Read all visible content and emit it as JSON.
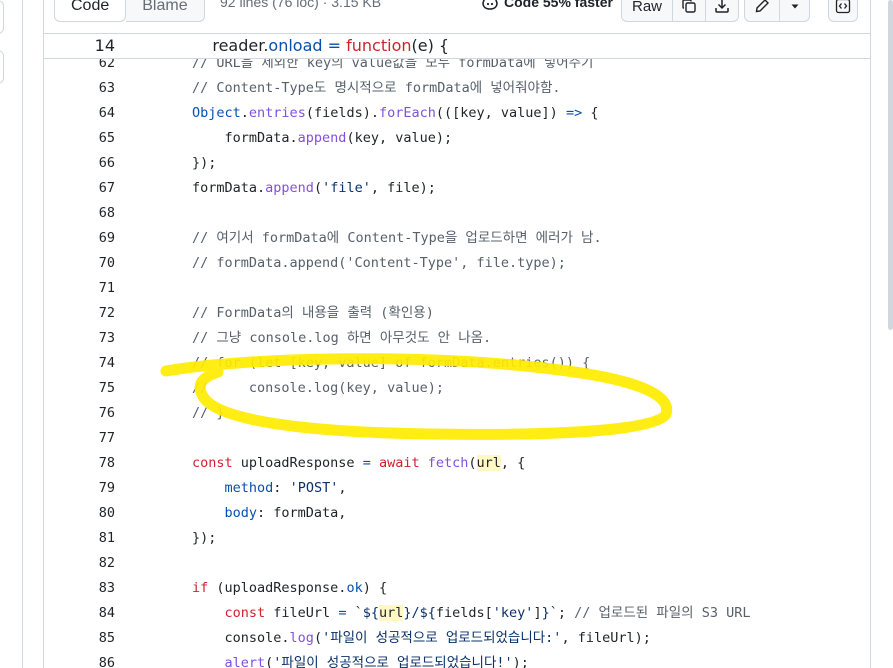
{
  "toolbar": {
    "code_label": "Code",
    "blame_label": "Blame",
    "file_meta": "92 lines (76 loc) · 3.15 KB",
    "copilot_label": "Code 55% faster",
    "raw_label": "Raw"
  },
  "sticky_line": {
    "num": "14",
    "html": "    reader.<span class=\"pr\">onload</span> <span class=\"op\">=</span> <span class=\"kw\">function</span>(e) {"
  },
  "code_lines": [
    {
      "num": "62",
      "html": "<span class=\"cm\">// URL을 제외한 key의 value값을 모두 formData에 넣어주기</span>"
    },
    {
      "num": "63",
      "html": "<span class=\"cm\">// Content-Type도 명시적으로 formData에 넣어줘야함.</span>"
    },
    {
      "num": "64",
      "html": "<span class=\"pr\">Object</span>.<span class=\"fn\">entries</span>(fields).<span class=\"fn\">forEach</span>(([key, value]) <span class=\"op\">=&gt;</span> {"
    },
    {
      "num": "65",
      "html": "    formData.<span class=\"fn\">append</span>(key, value);"
    },
    {
      "num": "66",
      "html": "});"
    },
    {
      "num": "67",
      "html": "formData.<span class=\"fn\">append</span>(<span class=\"st\">'file'</span>, file);"
    },
    {
      "num": "68",
      "html": ""
    },
    {
      "num": "69",
      "html": "<span class=\"cm\">// 여기서 formData에 Content-Type을 업로드하면 에러가 남.</span>"
    },
    {
      "num": "70",
      "html": "<span class=\"cm\">// formData.append('Content-Type', file.type);</span>"
    },
    {
      "num": "71",
      "html": ""
    },
    {
      "num": "72",
      "html": "<span class=\"cm\">// FormData의 내용을 출력 (확인용)</span>"
    },
    {
      "num": "73",
      "html": "<span class=\"cm\">// 그냥 console.log 하면 아무것도 안 나옴.</span>"
    },
    {
      "num": "74",
      "html": "<span class=\"cm\">// for (let [key, value] of formData.entries()) {</span>"
    },
    {
      "num": "75",
      "html": "<span class=\"cm\">//     console.log(key, value);</span>"
    },
    {
      "num": "76",
      "html": "<span class=\"cm\">// }</span>"
    },
    {
      "num": "77",
      "html": ""
    },
    {
      "num": "78",
      "html": "<span class=\"kw\">const</span> uploadResponse <span class=\"op\">=</span> <span class=\"kw\">await</span> <span class=\"fn\">fetch</span>(<span class=\"hl\">url</span>, {"
    },
    {
      "num": "79",
      "html": "    <span class=\"pr\">method</span>: <span class=\"st\">'POST'</span>,"
    },
    {
      "num": "80",
      "html": "    <span class=\"pr\">body</span>: formData,"
    },
    {
      "num": "81",
      "html": "});"
    },
    {
      "num": "82",
      "html": ""
    },
    {
      "num": "83",
      "html": "<span class=\"kw\">if</span> (uploadResponse.<span class=\"pr\">ok</span>) {"
    },
    {
      "num": "84",
      "html": "    <span class=\"kw\">const</span> fileUrl <span class=\"op\">=</span> <span class=\"st\">`${</span><span class=\"hl\">url</span><span class=\"st\">}/${</span>fields[<span class=\"st\">'key'</span>]<span class=\"st\">}`</span>; <span class=\"cm\">// 업로드된 파일의 S3 URL</span>"
    },
    {
      "num": "85",
      "html": "    console.<span class=\"fn\">log</span>(<span class=\"st\">'파일이 성공적으로 업로드되었습니다:'</span>, fileUrl);"
    },
    {
      "num": "86",
      "html": "    <span class=\"fn\">alert</span>(<span class=\"st\">'파일이 성공적으로 업로드되었습니다!'</span>);"
    }
  ],
  "colors": {
    "annotation_highlighter": "#ffeb00",
    "border": "#d0d7de"
  },
  "icons": [
    "copilot-icon",
    "copy-icon",
    "download-icon",
    "pencil-icon",
    "triangle-down-icon",
    "code-square-icon"
  ]
}
